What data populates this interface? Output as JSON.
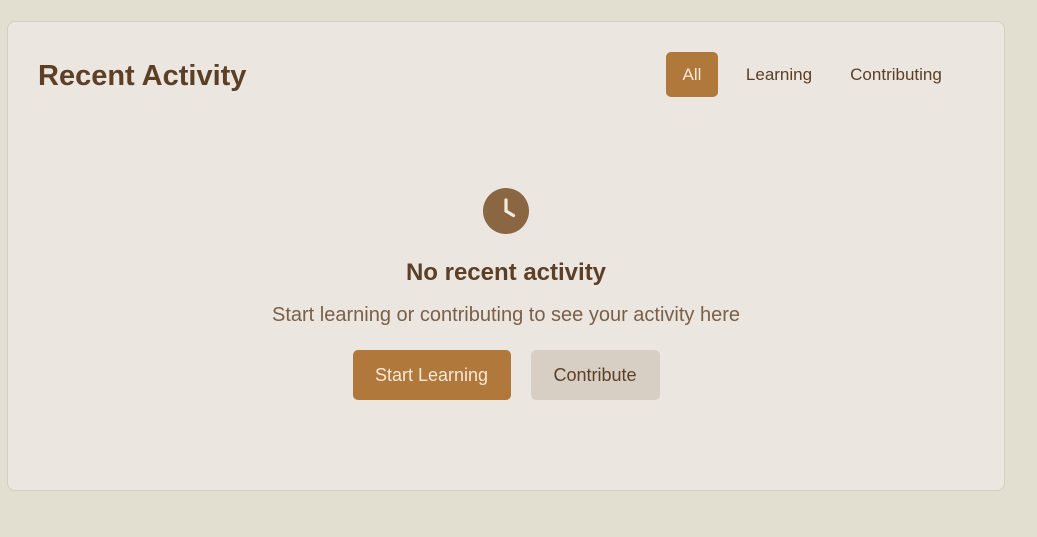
{
  "header": {
    "title": "Recent Activity"
  },
  "filters": {
    "all_label": "All",
    "learning_label": "Learning",
    "contributing_label": "Contributing",
    "selected": "All"
  },
  "empty_state": {
    "icon": "clock-icon",
    "title": "No recent activity",
    "subtitle": "Start learning or contributing to see your activity here",
    "primary_button": "Start Learning",
    "secondary_button": "Contribute"
  },
  "colors": {
    "page_background": "#e2ded0",
    "card_background": "#ebe6e0",
    "accent": "#b0783a",
    "text_primary": "#5c3f25",
    "text_secondary": "#7a6048",
    "secondary_button": "#d7cec4",
    "icon_fill": "#8a6642"
  }
}
